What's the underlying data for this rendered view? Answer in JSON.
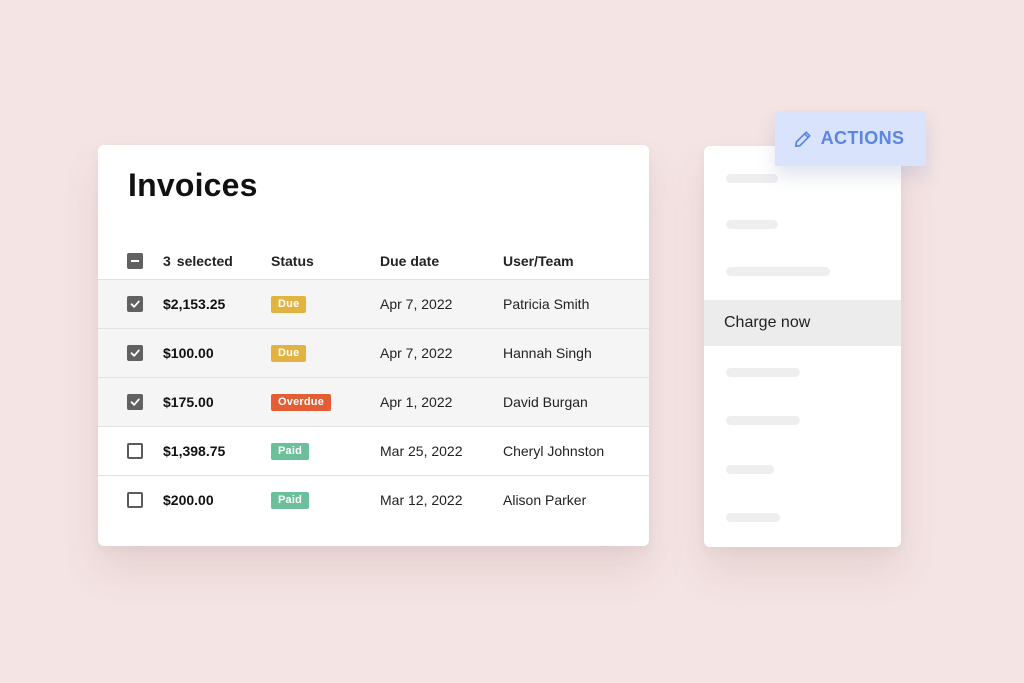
{
  "invoices": {
    "title": "Invoices",
    "header": {
      "selected_count": "3",
      "selected_label": "selected",
      "status": "Status",
      "due_date": "Due date",
      "user_team": "User/Team"
    },
    "rows": [
      {
        "checked": true,
        "amount": "$2,153.25",
        "status": "Due",
        "due_date": "Apr 7, 2022",
        "user": "Patricia Smith"
      },
      {
        "checked": true,
        "amount": "$100.00",
        "status": "Due",
        "due_date": "Apr 7, 2022",
        "user": "Hannah Singh"
      },
      {
        "checked": true,
        "amount": "$175.00",
        "status": "Overdue",
        "due_date": "Apr 1, 2022",
        "user": "David Burgan"
      },
      {
        "checked": false,
        "amount": "$1,398.75",
        "status": "Paid",
        "due_date": "Mar 25, 2022",
        "user": "Cheryl Johnston"
      },
      {
        "checked": false,
        "amount": "$200.00",
        "status": "Paid",
        "due_date": "Mar 12, 2022",
        "user": "Alison Parker"
      }
    ]
  },
  "status_colors": {
    "Due": "#e3b341",
    "Overdue": "#e35d35",
    "Paid": "#6bbf9b"
  },
  "actions": {
    "button_label": "ACTIONS",
    "button_icon": "pencil-icon",
    "accent_color": "#5b86e3",
    "active_item": "Charge now"
  },
  "colors": {
    "background": "#f4e4e3",
    "checkbox": "#616161"
  }
}
